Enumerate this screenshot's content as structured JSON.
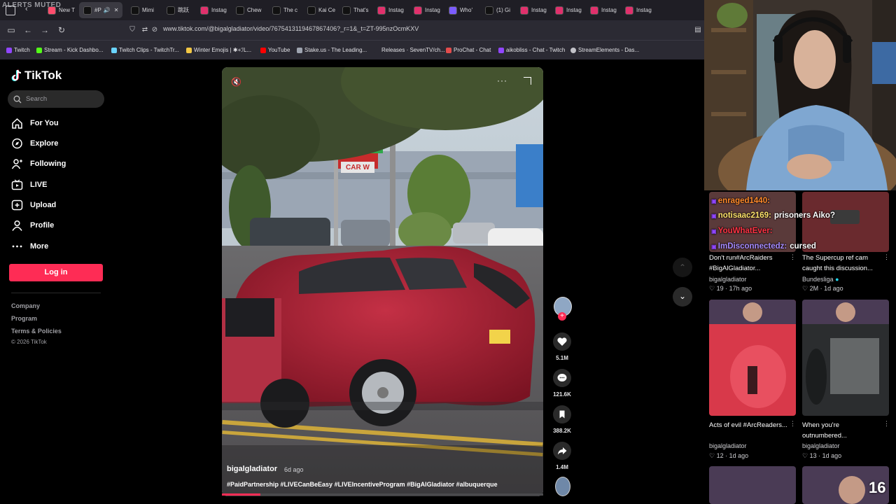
{
  "overlay": {
    "alerts": "ALERTS MUTED",
    "sub_count": "16"
  },
  "tabs": [
    "New T",
    "#P",
    "Mimi",
    "跳跃",
    "Instag",
    "Chew",
    "The c",
    "Kai Ce",
    "That's",
    "Instag",
    "Instag",
    "Who'",
    "(1) Gi",
    "Instag",
    "Instag",
    "Instag",
    "Instag"
  ],
  "address": {
    "url": "www.tiktok.com/@bigalgladiator/video/7675413119467867406?_r=1&_t=ZT-995nzOcmKXV"
  },
  "bookmarks": [
    "Twitch",
    "Stream - Kick Dashbo...",
    "Twitch Clips - TwitchTr...",
    "Winter Emojis | ✱+ℐL...",
    "YouTube",
    "Stake.us - The Leading...",
    "Releases · SevenTV/ch...",
    "ProChat - Chat",
    "aikobliss - Chat - Twitch",
    "StreamElements - Das..."
  ],
  "tiktok": {
    "logo": "TikTok",
    "search_placeholder": "Search",
    "nav": [
      "For You",
      "Explore",
      "Following",
      "LIVE",
      "Upload",
      "Profile",
      "More"
    ],
    "login": "Log in",
    "footer": [
      "Company",
      "Program",
      "Terms & Policies",
      "© 2026 TikTok"
    ],
    "video": {
      "author": "bigalgladiator",
      "time": "6d ago",
      "caption": "#PaidPartnership #LIVECanBeEasy #LIVEIncentiveProgram #BigAlGladiator #albuquerque",
      "sign_text": "CAR W"
    },
    "actions": {
      "likes": "5.1M",
      "comments": "121.6K",
      "saves": "388.2K",
      "shares": "1.4M"
    },
    "progress": 0.12
  },
  "chat": [
    {
      "user": "enraged1440:",
      "msg": "",
      "color": "#ff8a2b"
    },
    {
      "user": "notisaac2169:",
      "msg": "prisoners Aiko?",
      "color": "#ffe36b"
    },
    {
      "user": "YouWhatEver:",
      "msg": "",
      "color": "#ff3344"
    },
    {
      "user": "ImDisconnectedz:",
      "msg": "cursed",
      "color": "#a78bff"
    }
  ],
  "cards": [
    {
      "title": "Don't run#ArcRaiders #BigAlGladiator...",
      "author": "bigalgladiator",
      "likes": "19",
      "time": "17h ago"
    },
    {
      "title": "The Supercup ref cam caught this discussion...",
      "author": "Bundesliga",
      "likes": "2M",
      "time": "1d ago"
    },
    {
      "title": "Acts of evil #ArcReaders...",
      "author": "bigalgladiator",
      "likes": "12",
      "time": "1d ago"
    },
    {
      "title": "When you're outnumbered...",
      "author": "bigalgladiator",
      "likes": "13",
      "time": "1d ago"
    }
  ],
  "colors": {
    "accent": "#fe2c55",
    "chrome": "#2b2a33",
    "tabbar": "#1f1e25"
  }
}
